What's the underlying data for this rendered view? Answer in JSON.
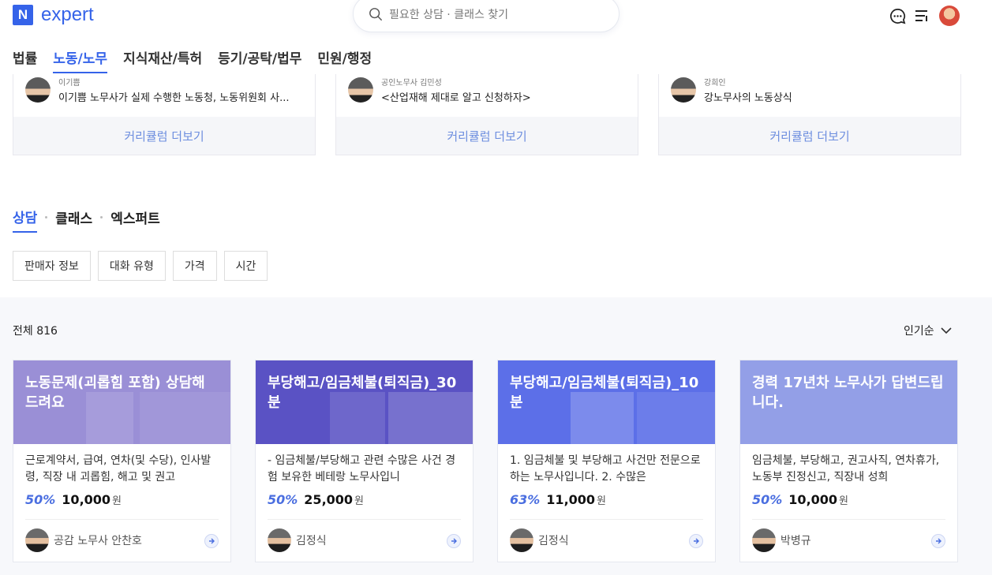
{
  "header": {
    "logo_mark": "N",
    "logo_text": "expert",
    "search_placeholder": "필요한 상담 · 클래스 찾기",
    "icons": [
      "chat-icon",
      "menu-icon",
      "avatar"
    ]
  },
  "categories": [
    {
      "label": "법률",
      "active": false
    },
    {
      "label": "노동/노무",
      "active": true
    },
    {
      "label": "지식재산/특허",
      "active": false
    },
    {
      "label": "등기/공탁/법무",
      "active": false
    },
    {
      "label": "민원/행정",
      "active": false
    }
  ],
  "curricula": [
    {
      "author": "이기쁨",
      "title": "이기쁨 노무사가 실제 수행한 노동청, 노동위원회 사...",
      "more": "커리큘럼 더보기"
    },
    {
      "author": "공인노무사 김민성",
      "title": "<산업재해 제대로 알고 신청하자>",
      "more": "커리큘럼 더보기"
    },
    {
      "author": "강희인",
      "title": "강노무사의 노동상식",
      "more": "커리큘럼 더보기"
    }
  ],
  "sub_tabs": [
    {
      "label": "상담",
      "active": true
    },
    {
      "label": "클래스",
      "active": false
    },
    {
      "label": "엑스퍼트",
      "active": false
    }
  ],
  "filters": [
    "판매자 정보",
    "대화 유형",
    "가격",
    "시간"
  ],
  "listing": {
    "total_label": "전체 816",
    "sort_label": "인기순"
  },
  "cards": [
    {
      "title": "노동문제(괴롭힘 포함) 상담해 드려요",
      "desc": "근로계약서, 급여, 연차(및 수당), 인사발령, 직장 내 괴롭힘, 해고 및 권고",
      "discount": "50%",
      "price": "10,000",
      "unit": "원",
      "seller": "공감 노무사 안찬호",
      "color": "#9a8fd6"
    },
    {
      "title": "부당해고/임금체불(퇴직금)_30분",
      "desc": "- 임금체불/부당해고 관련 수많은 사건 경험 보유한 베테랑 노무사입니",
      "discount": "50%",
      "price": "25,000",
      "unit": "원",
      "seller": "김정식",
      "color": "#5a52c4"
    },
    {
      "title": "부당해고/임금체불(퇴직금)_10분",
      "desc": "1. 임금체불 및 부당해고 사건만 전문으로 하는 노무사입니다. 2. 수많은",
      "discount": "63%",
      "price": "11,000",
      "unit": "원",
      "seller": "김정식",
      "color": "#5c6fe8"
    },
    {
      "title": "경력 17년차 노무사가 답변드립니다.",
      "desc": "임금체불, 부당해고, 권고사직, 연차휴가, 노동부 진정신고, 직장내 성희",
      "discount": "50%",
      "price": "10,000",
      "unit": "원",
      "seller": "박병규",
      "color": "#8d9ae6"
    }
  ]
}
